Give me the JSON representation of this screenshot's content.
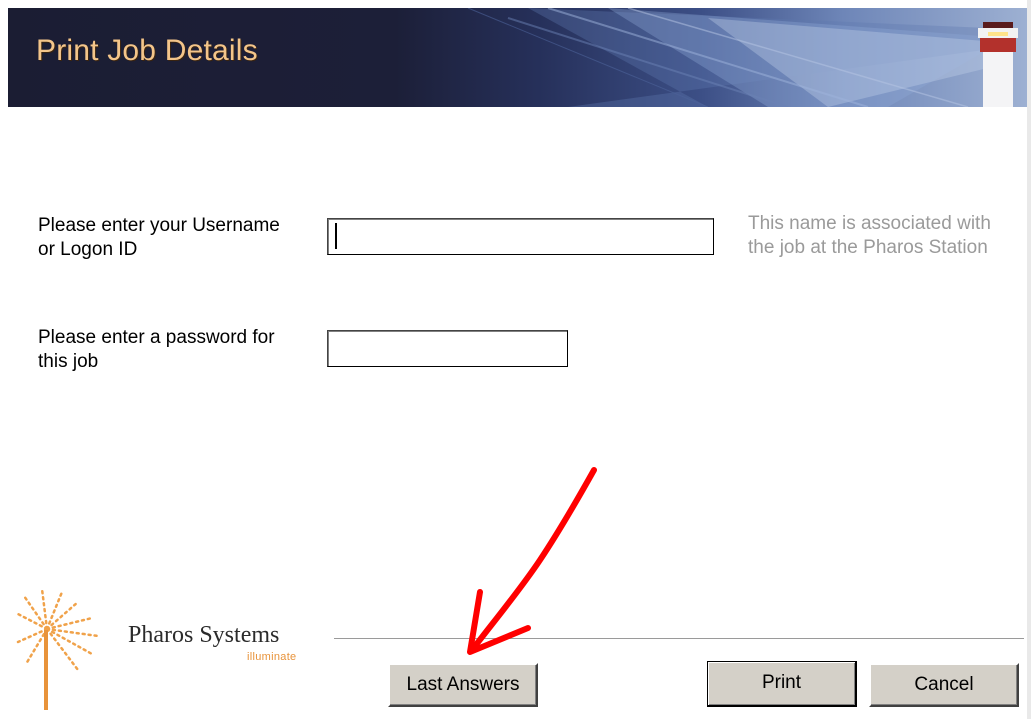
{
  "banner": {
    "title": "Print Job Details"
  },
  "form": {
    "username_label_line1": "Please enter your Username",
    "username_label_line2": "or Logon ID",
    "username_value": "",
    "username_hint_line1": "This name is associated with",
    "username_hint_line2": "the job at the Pharos Station",
    "password_label_line1": "Please enter a password for",
    "password_label_line2": "this job",
    "password_value": ""
  },
  "branding": {
    "logo_text": "Pharos Systems",
    "logo_subtext": "illuminate"
  },
  "buttons": {
    "last_answers": "Last Answers",
    "print": "Print",
    "cancel": "Cancel"
  },
  "annotation": {
    "arrow_color": "#ff0000"
  },
  "colors": {
    "title": "#f3c58a",
    "hint": "#9a9a9a",
    "button_face": "#d4d0c8"
  }
}
